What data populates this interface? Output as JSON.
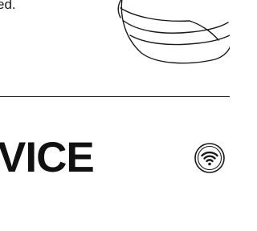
{
  "description_tail": "ed.",
  "section": {
    "heading": "VICE"
  },
  "icons": {
    "illustration": "face-mask-illustration",
    "connectivity": "wifi-icon"
  },
  "colors": {
    "ink": "#1a1a1a",
    "background": "#ffffff"
  }
}
